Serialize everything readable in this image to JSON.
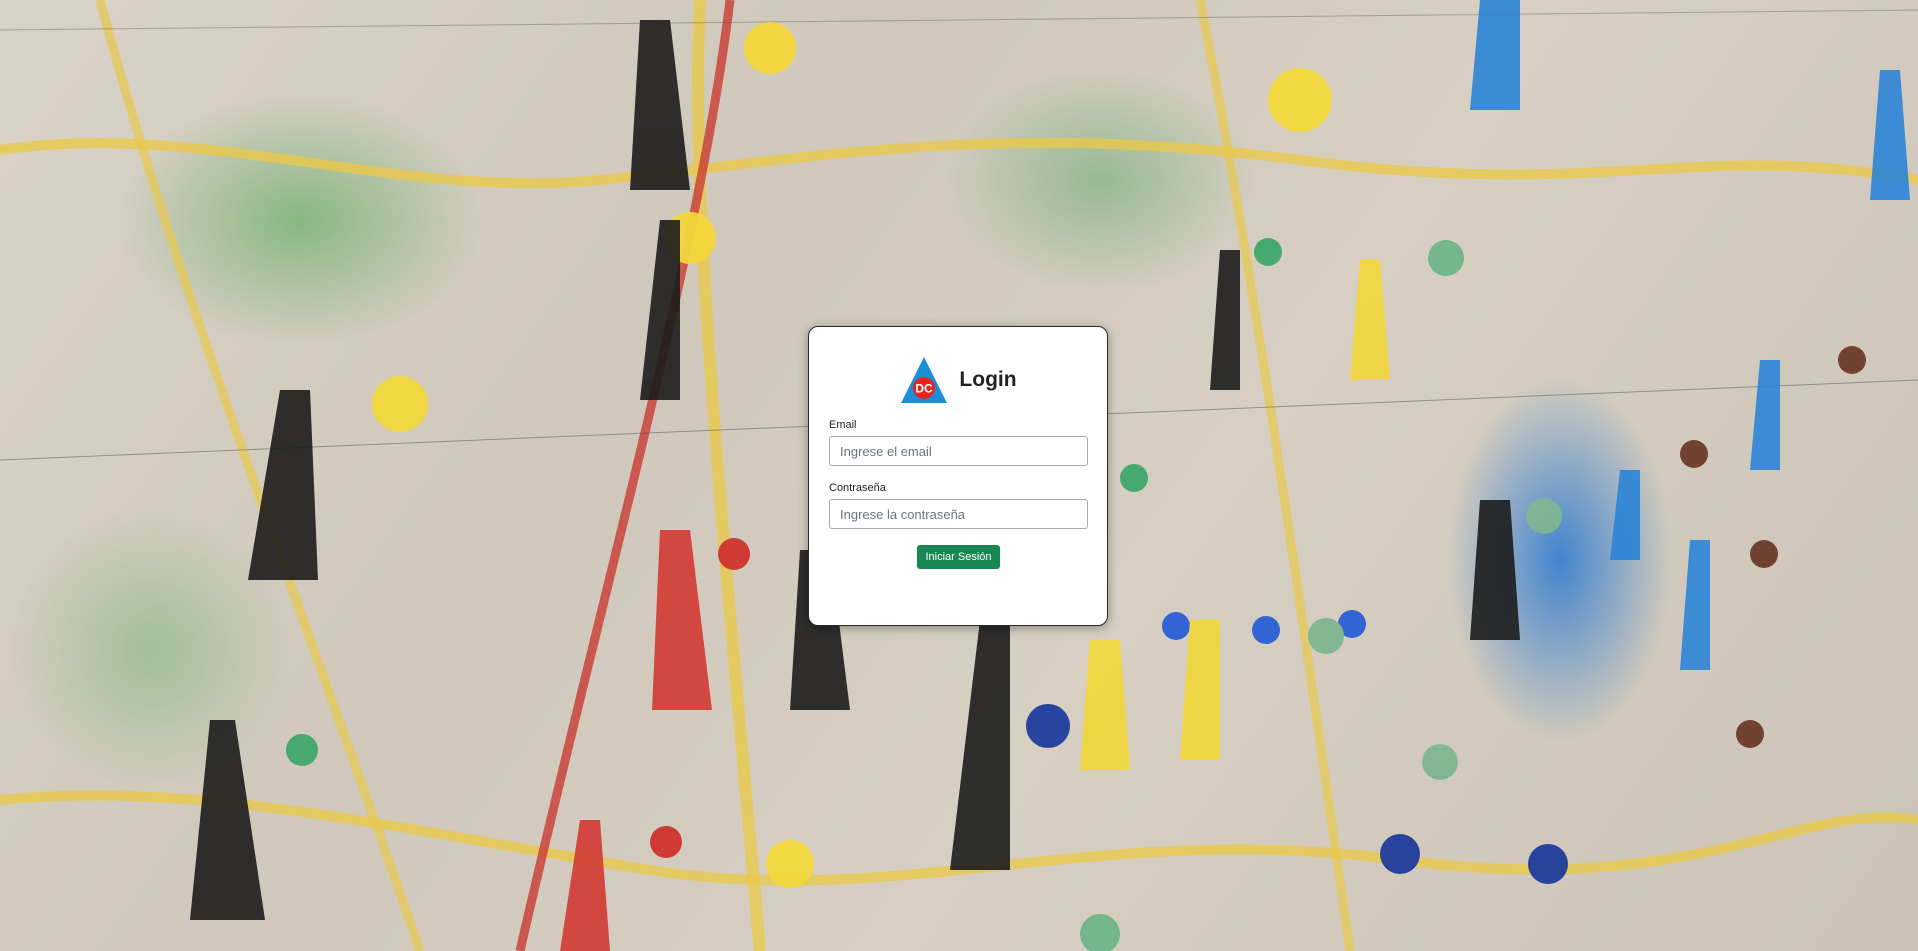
{
  "login": {
    "title": "Login",
    "logo": {
      "text": "DC",
      "colors": {
        "triangle": "#1a8fd8",
        "circle": "#e52420",
        "text": "#ffffff"
      }
    },
    "email_label": "Email",
    "email_placeholder": "Ingrese el email",
    "password_label": "Contraseña",
    "password_placeholder": "Ingrese la contraseña",
    "submit_label": "Iniciar Sesión"
  },
  "background": {
    "description_icon": "map-background",
    "colors": {
      "button": "#198754"
    }
  }
}
